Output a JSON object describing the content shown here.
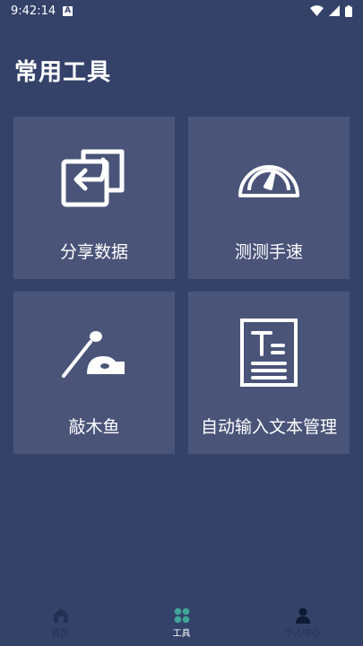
{
  "status_bar": {
    "time": "9:42:14",
    "notification_icon": "a-box-icon",
    "icons": [
      "wifi-icon",
      "signal-icon",
      "battery-icon"
    ]
  },
  "page": {
    "title": "常用工具"
  },
  "tools": [
    {
      "label": "分享数据",
      "icon": "share-data-icon"
    },
    {
      "label": "测测手速",
      "icon": "speedometer-icon"
    },
    {
      "label": "敲木鱼",
      "icon": "wooden-fish-icon"
    },
    {
      "label": "自动输入文本管理",
      "icon": "text-document-icon"
    }
  ],
  "bottom_nav": {
    "items": [
      {
        "label": "首页",
        "icon": "home-icon",
        "active": false
      },
      {
        "label": "工具",
        "icon": "grid-icon",
        "active": true
      },
      {
        "label": "个人中心",
        "icon": "person-icon",
        "active": false
      }
    ]
  },
  "colors": {
    "background": "#34426a",
    "card": "#4a5479",
    "accent": "#3fa796",
    "nav_inactive": "#243052"
  }
}
